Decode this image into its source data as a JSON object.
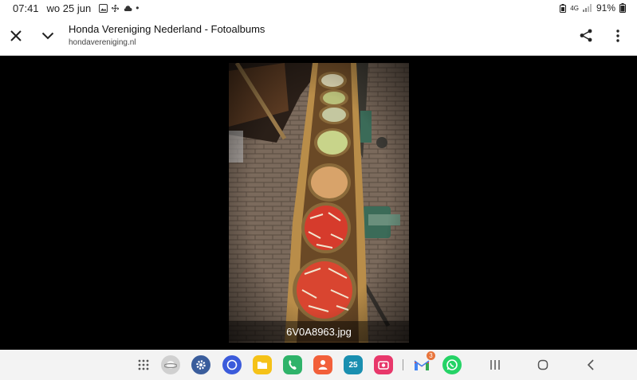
{
  "status_bar": {
    "time": "07:41",
    "date": "wo 25 jun",
    "network": "4G",
    "battery": "91%"
  },
  "toolbar": {
    "title": "Honda Vereniging Nederland - Fotoalbums",
    "url": "hondavereniging.nl"
  },
  "viewer": {
    "filename": "6V0A8963.jpg"
  },
  "taskbar": {
    "apps": [
      {
        "name": "app-drawer",
        "color": "#777777"
      },
      {
        "name": "internet-browser",
        "color": "#c9c9c9"
      },
      {
        "name": "settings",
        "color": "#3a5d9c"
      },
      {
        "name": "messages",
        "color": "#3b5bdb"
      },
      {
        "name": "my-files",
        "color": "#f5c218"
      },
      {
        "name": "phone",
        "color": "#2fb36a"
      },
      {
        "name": "contacts",
        "color": "#f25f3a"
      },
      {
        "name": "calendar",
        "color": "#1a8fb0",
        "label": "25"
      },
      {
        "name": "screen-recorder",
        "color": "#e8386b"
      },
      {
        "name": "gmail",
        "color": "#ffffff",
        "badge": "3"
      },
      {
        "name": "whatsapp",
        "color": "#25d366"
      }
    ]
  }
}
